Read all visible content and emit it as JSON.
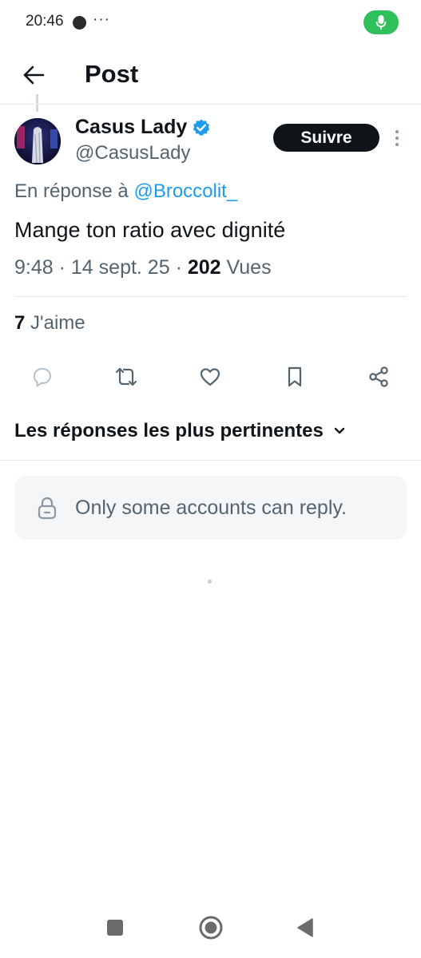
{
  "status_bar": {
    "time": "20:46",
    "more": "···",
    "mic_color": "#2fbf5b"
  },
  "header": {
    "title": "Post",
    "back_icon": "arrow-left-icon"
  },
  "post": {
    "author": {
      "name": "Casus Lady",
      "handle": "@CasusLady",
      "verified": true,
      "verified_color": "#1d9bf0"
    },
    "follow_label": "Suivre",
    "reply_prefix": "En réponse à",
    "reply_to": "@Broccolit_",
    "text": "Mange ton ratio avec dignité",
    "time": "9:48",
    "date": "14 sept. 25",
    "separator": "·",
    "views_count": "202",
    "views_label": "Vues",
    "likes_count": "7",
    "likes_label": "J'aime"
  },
  "actions": [
    {
      "name": "reply",
      "icon": "comment-icon"
    },
    {
      "name": "repost",
      "icon": "repost-icon"
    },
    {
      "name": "like",
      "icon": "heart-icon"
    },
    {
      "name": "bookmark",
      "icon": "bookmark-icon"
    },
    {
      "name": "share",
      "icon": "share-icon"
    }
  ],
  "replies": {
    "sort_label": "Les réponses les plus pertinentes",
    "restriction_text": "Only some accounts can reply."
  },
  "nav_bar": {
    "items": [
      "recents-button",
      "home-button",
      "back-button"
    ]
  }
}
